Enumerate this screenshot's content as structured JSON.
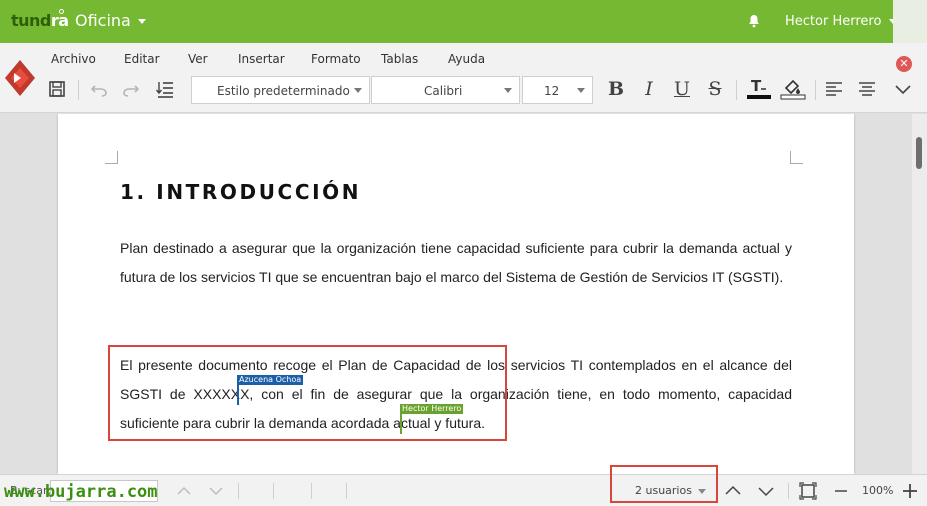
{
  "topbar": {
    "logo_prefix": "tund",
    "logo_suffix": "ra",
    "app_title": "Oficina",
    "user_name": "Hector Herrero",
    "background": "#75b831"
  },
  "menu": [
    "Archivo",
    "Editar",
    "Ver",
    "Insertar",
    "Formato",
    "Tablas",
    "Ayuda"
  ],
  "toolbar": {
    "style_select": "Estilo predeterminado",
    "font_select": "Calibri",
    "size_select": "12",
    "bold": "B",
    "italic": "I",
    "underline": "U",
    "strike": "S"
  },
  "document": {
    "heading": "1.   INTRODUCCIÓN",
    "paragraph1": "Plan destinado a asegurar que la organización tiene capacidad suficiente para cubrir la demanda actual y futura de los  servicios TI que se encuentran bajo el marco del Sistema de Gestión de Servicios IT (SGSTI).",
    "paragraph2": "El presente documento recoge el Plan de Capacidad de los servicios TI contemplados en el alcance del SGSTI de XXXXXX, con el fin de asegurar que la organización tiene, en todo momento, capacidad suficiente para cubrir la demanda acordada actual y futura.",
    "cursors": [
      {
        "name": "Azucena Ochoa",
        "color": "#1c5fa8"
      },
      {
        "name": "Hector Herrero",
        "color": "#6aa22e"
      }
    ]
  },
  "statusbar": {
    "search_label": "Buscar:",
    "search_value": "",
    "users": "2 usuarios",
    "zoom": "100%",
    "watermark": "www.bujarra.com"
  },
  "colors": {
    "highlight_border": "#d9473a",
    "accent_green": "#75b831"
  }
}
